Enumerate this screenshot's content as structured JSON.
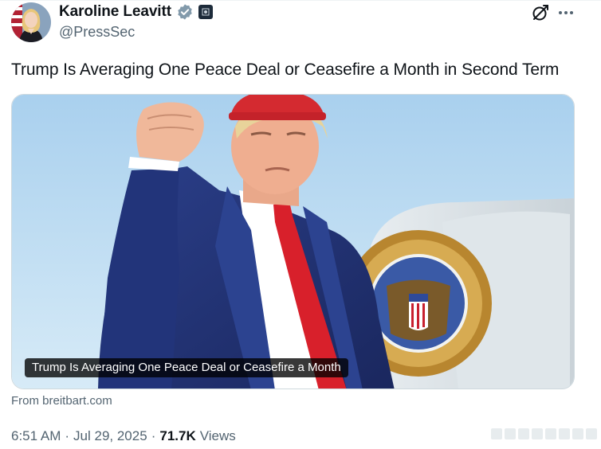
{
  "author": {
    "display_name": "Karoline Leavitt",
    "handle": "@PressSec",
    "verified_badge_color": "#829aab"
  },
  "header_icons": {
    "grok": "grok-icon",
    "more": "more-icon"
  },
  "tweet": {
    "text": "Trump Is Averaging One Peace Deal or Ceasefire a Month in Second Term"
  },
  "card": {
    "caption": "Trump Is Averaging One Peace Deal or Ceasefire a Month",
    "source": "From breitbart.com"
  },
  "meta": {
    "time": "6:51 AM",
    "date": "Jul 29, 2025",
    "views_count": "71.7K",
    "views_label": "Views",
    "separator": "·"
  },
  "colors": {
    "secondary_text": "#536471",
    "primary_text": "#0f1419",
    "border": "#cfd9de"
  }
}
